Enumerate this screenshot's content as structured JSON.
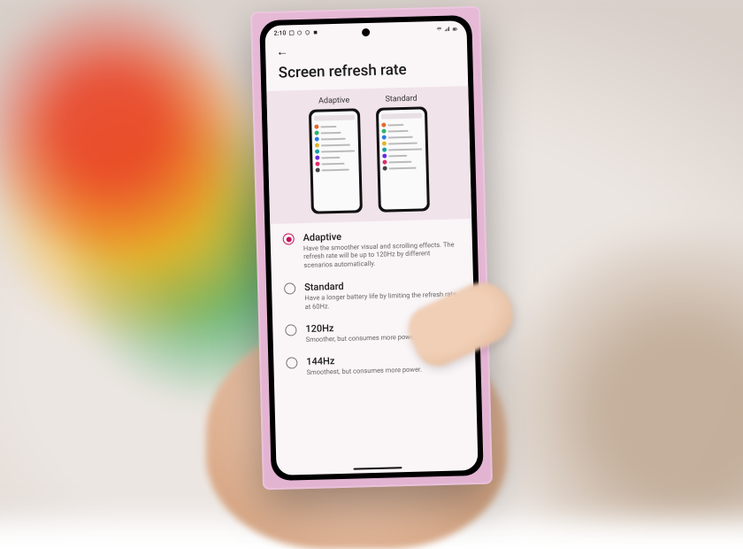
{
  "status": {
    "time": "2:10",
    "battery": "▮"
  },
  "page": {
    "title": "Screen refresh rate"
  },
  "previews": [
    {
      "label": "Adaptive"
    },
    {
      "label": "Standard"
    }
  ],
  "options": [
    {
      "key": "adaptive",
      "name": "Adaptive",
      "desc": "Have the smoother visual and scrolling effects. The refresh rate will be up to 120Hz by different scenarios automatically.",
      "selected": true
    },
    {
      "key": "standard",
      "name": "Standard",
      "desc": "Have a longer battery life by limiting the refresh rate at 60Hz.",
      "selected": false
    },
    {
      "key": "hz120",
      "name": "120Hz",
      "desc": "Smoother, but consumes more power.",
      "selected": false
    },
    {
      "key": "hz144",
      "name": "144Hz",
      "desc": "Smoothest, but consumes more power.",
      "selected": false
    }
  ],
  "mini_colors": [
    "#e06a2b",
    "#2bb56a",
    "#2b7de0",
    "#e0b52b",
    "#15a0a0",
    "#6a2be0",
    "#e02b6a",
    "#444"
  ]
}
